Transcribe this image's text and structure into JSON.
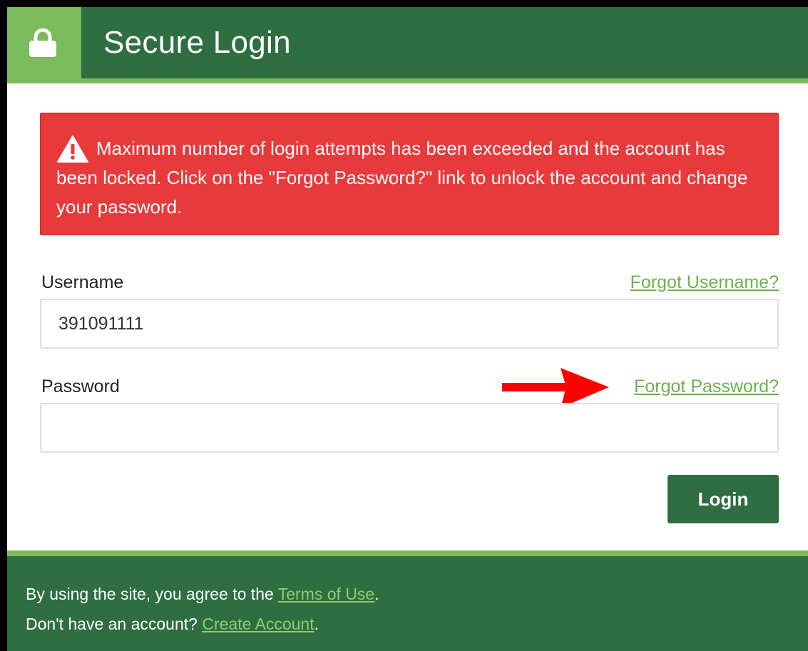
{
  "header": {
    "title": "Secure Login",
    "icon": "lock-icon"
  },
  "alert": {
    "icon": "warning-icon",
    "message": "Maximum number of login attempts has been exceeded and the account has been locked. Click on the \"Forgot Password?\" link to unlock the account and change your password."
  },
  "form": {
    "username_label": "Username",
    "forgot_username": "Forgot Username?",
    "username_value": "391091111",
    "password_label": "Password",
    "forgot_password": "Forgot Password?",
    "password_value": "",
    "login_label": "Login"
  },
  "footer": {
    "line1_prefix": "By using the site, you agree to the ",
    "terms_link": "Terms of Use",
    "line1_suffix": ".",
    "line2_prefix": "Don't have an account? ",
    "create_link": "Create Account",
    "line2_suffix": "."
  },
  "colors": {
    "header_green": "#2e6e40",
    "accent_green": "#7cbb5b",
    "alert_red": "#e8393b",
    "link_green": "#6ab44a",
    "arrow_red": "#ff0000"
  }
}
